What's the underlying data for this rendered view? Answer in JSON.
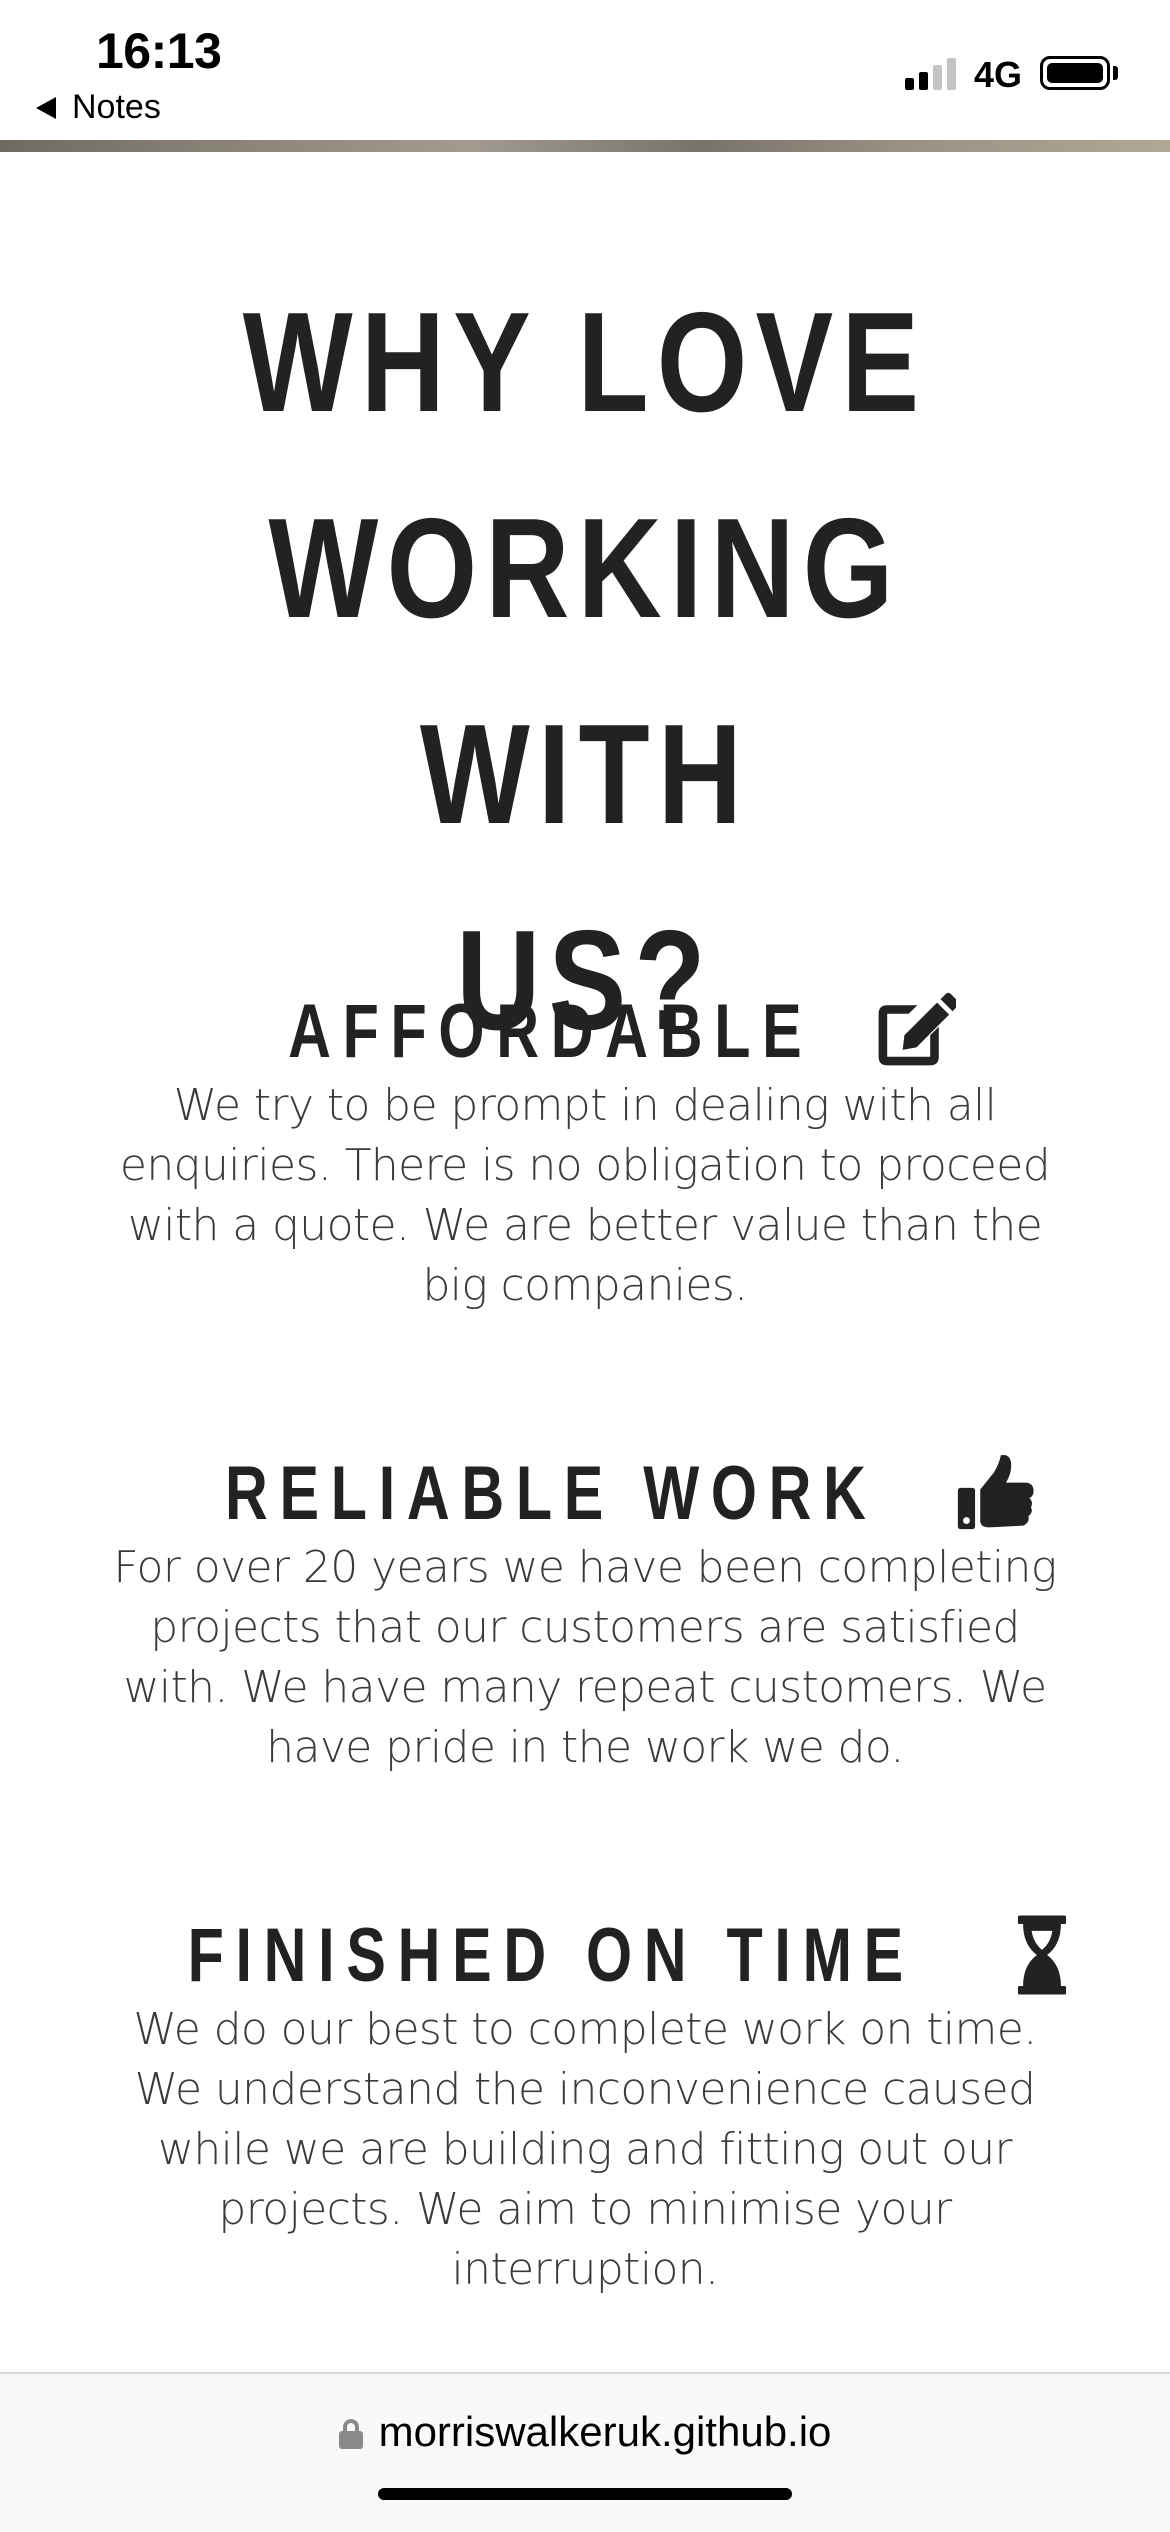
{
  "status_bar": {
    "time": "16:13",
    "back_label": "Notes",
    "network": "4G",
    "signal_icon": "cellular-signal-icon",
    "battery_icon": "battery-icon"
  },
  "main": {
    "title_lines": [
      "WHY LOVE",
      "WORKING WITH",
      "US?"
    ],
    "features": [
      {
        "title": "AFFORDABLE",
        "icon": "edit-icon",
        "text": "We try to be prompt in dealing with all enquiries. There is no obligation to proceed with a quote. We are better value than the big companies."
      },
      {
        "title": "RELIABLE WORK",
        "icon": "thumbs-up-icon",
        "text": "For over 20 years we have been completing projects that our customers are satisfied with. We have many repeat customers. We have pride in the work we do."
      },
      {
        "title": "FINISHED ON TIME",
        "icon": "hourglass-icon",
        "text": "We do our best to complete work on time. We understand the inconvenience caused while we are building and fitting out our projects. We aim to minimise your interruption."
      }
    ]
  },
  "browser": {
    "url": "morriswalkeruk.github.io",
    "lock_icon": "lock-icon"
  },
  "colors": {
    "text": "#222222",
    "body_text": "#3a3a3a",
    "background": "#ffffff",
    "url_bar": "#f9f9f9"
  }
}
